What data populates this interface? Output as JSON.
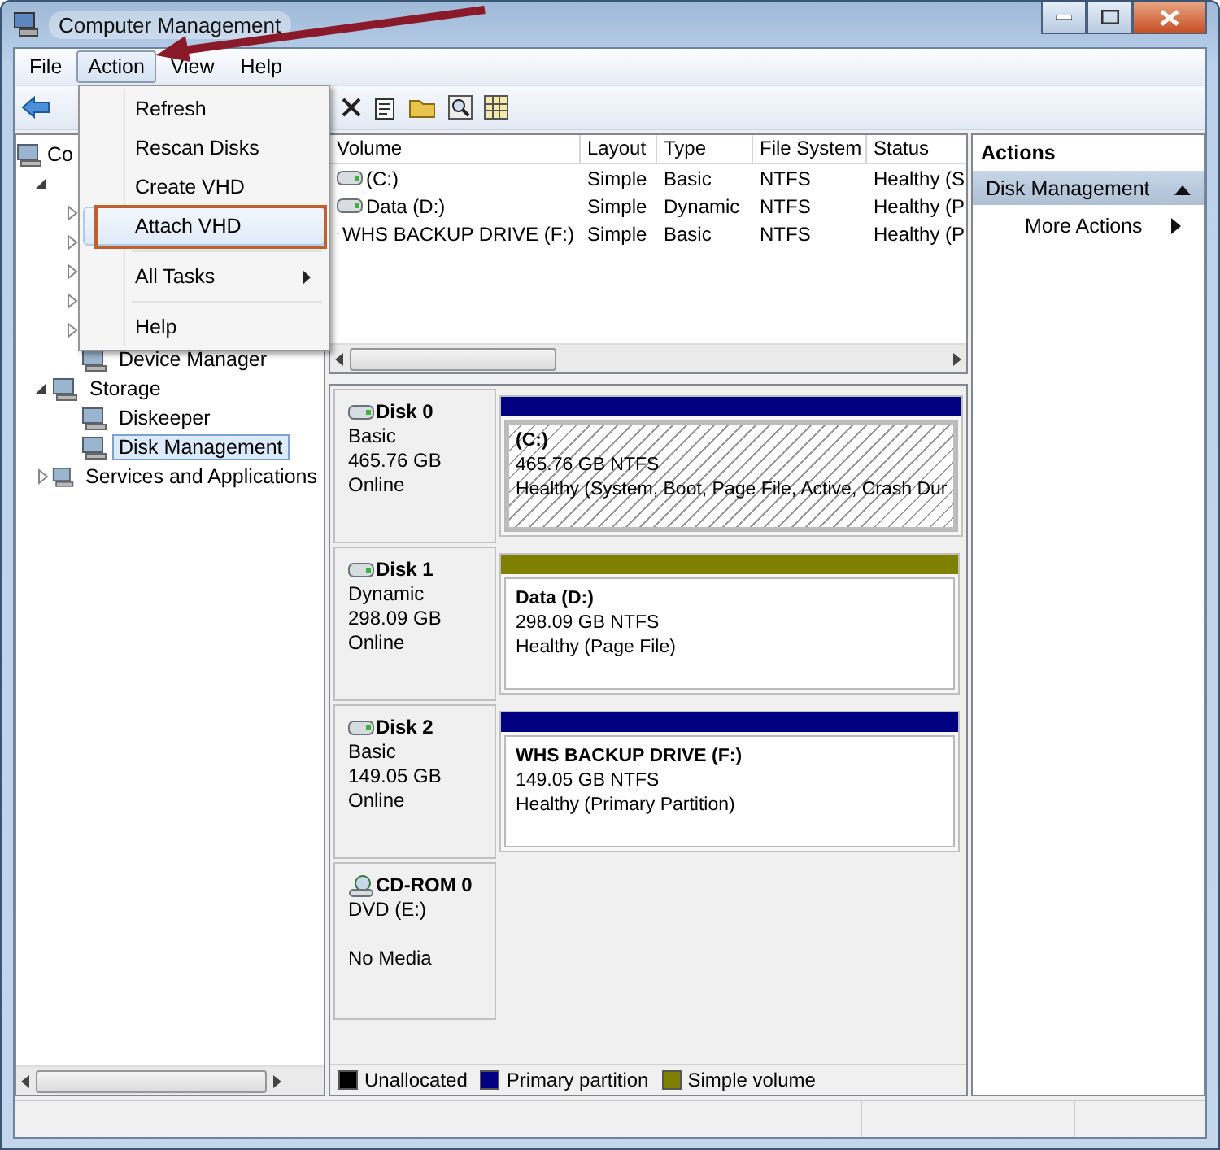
{
  "window": {
    "title": "Computer Management"
  },
  "menu_bar": [
    {
      "label": "File",
      "selected": false
    },
    {
      "label": "Action",
      "selected": true
    },
    {
      "label": "View",
      "selected": false
    },
    {
      "label": "Help",
      "selected": false
    }
  ],
  "action_menu": [
    {
      "kind": "item",
      "label": "Refresh",
      "highlighted": false
    },
    {
      "kind": "item",
      "label": "Rescan Disks",
      "highlighted": false
    },
    {
      "kind": "item",
      "label": "Create VHD",
      "highlighted": false
    },
    {
      "kind": "item",
      "label": "Attach VHD",
      "highlighted": true
    },
    {
      "kind": "separator"
    },
    {
      "kind": "submenu",
      "label": "All Tasks",
      "highlighted": false
    },
    {
      "kind": "separator"
    },
    {
      "kind": "item",
      "label": "Help",
      "highlighted": false
    }
  ],
  "tree": [
    {
      "label": "Co",
      "children": [
        {
          "expanded": true,
          "children": [
            {
              "expanded": false
            },
            {
              "expanded": false
            },
            {
              "expanded": false
            },
            {
              "expanded": false
            },
            {
              "expanded": false
            },
            {
              "label": "Device Manager",
              "selected": false
            }
          ]
        },
        {
          "label": "Storage",
          "expanded": true,
          "selected": false,
          "children": [
            {
              "label": "Diskeeper",
              "selected": false
            },
            {
              "label": "Disk Management",
              "selected": true
            }
          ]
        },
        {
          "label": "Services and Applications",
          "expanded": false,
          "selected": false
        }
      ]
    }
  ],
  "volumes": {
    "columns": [
      "Volume",
      "Layout",
      "Type",
      "File System",
      "Status"
    ],
    "rows": [
      [
        "(C:)",
        "Simple",
        "Basic",
        "NTFS",
        "Healthy (S"
      ],
      [
        "Data (D:)",
        "Simple",
        "Dynamic",
        "NTFS",
        "Healthy (P"
      ],
      [
        "WHS BACKUP DRIVE (F:)",
        "Simple",
        "Basic",
        "NTFS",
        "Healthy (P"
      ]
    ]
  },
  "disks": [
    {
      "kind": "disk",
      "name": "Disk 0",
      "type": "Basic",
      "size": "465.76 GB",
      "status": "Online",
      "partitions": [
        {
          "title": "(C:)",
          "size": "465.76 GB NTFS",
          "status": "Healthy (System, Boot, Page File, Active, Crash Dur",
          "color": "#000080",
          "selected": true
        }
      ]
    },
    {
      "kind": "disk",
      "name": "Disk 1",
      "type": "Dynamic",
      "size": "298.09 GB",
      "status": "Online",
      "partitions": [
        {
          "title": "Data  (D:)",
          "size": "298.09 GB NTFS",
          "status": "Healthy (Page File)",
          "color": "#808000",
          "selected": false
        }
      ]
    },
    {
      "kind": "disk",
      "name": "Disk 2",
      "type": "Basic",
      "size": "149.05 GB",
      "status": "Online",
      "partitions": [
        {
          "title": "WHS BACKUP DRIVE  (F:)",
          "size": "149.05 GB NTFS",
          "status": "Healthy (Primary Partition)",
          "color": "#000080",
          "selected": false
        }
      ]
    },
    {
      "kind": "cdrom",
      "name": "CD-ROM 0",
      "type": "DVD (E:)",
      "status": "No Media"
    }
  ],
  "legend": [
    {
      "label": "Unallocated",
      "color": "#000000"
    },
    {
      "label": "Primary partition",
      "color": "#000080"
    },
    {
      "label": "Simple volume",
      "color": "#808000"
    }
  ],
  "actions": {
    "title": "Actions",
    "sections": [
      {
        "label": "Disk Management",
        "expanded": true,
        "items": [
          {
            "label": "More Actions"
          }
        ]
      }
    ]
  }
}
